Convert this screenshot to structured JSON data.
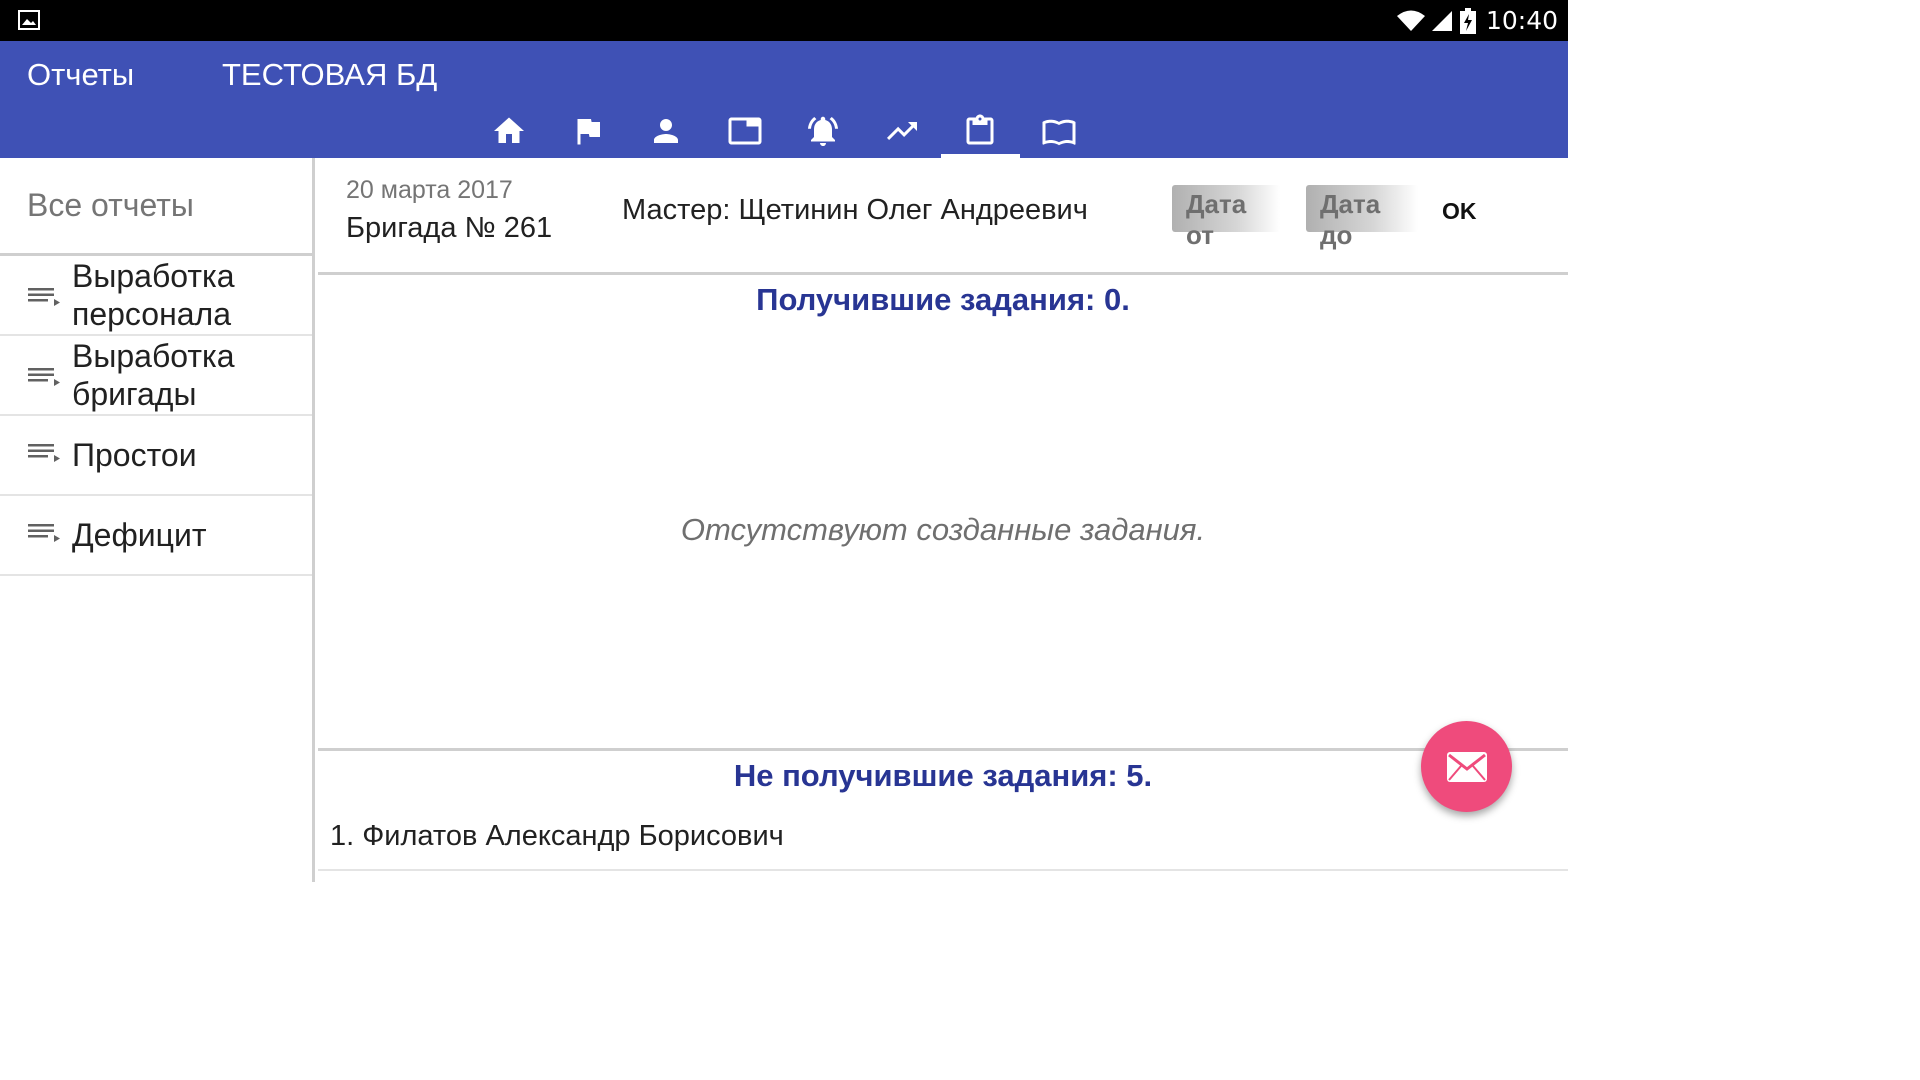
{
  "status_bar": {
    "time": "10:40",
    "icons": [
      "gallery-icon",
      "wifi-icon",
      "signal-icon",
      "battery-charging-icon"
    ]
  },
  "app_bar": {
    "title": "Отчеты",
    "subtitle": "ТЕСТОВАЯ БД",
    "tabs": [
      {
        "icon": "home-icon",
        "active": false
      },
      {
        "icon": "flag-icon",
        "active": false
      },
      {
        "icon": "person-icon",
        "active": false
      },
      {
        "icon": "tab-window-icon",
        "active": false
      },
      {
        "icon": "alarm-bell-icon",
        "active": false
      },
      {
        "icon": "trending-up-icon",
        "active": false
      },
      {
        "icon": "clipboard-icon",
        "active": true
      },
      {
        "icon": "book-icon",
        "active": false
      }
    ]
  },
  "sidebar": {
    "header": "Все отчеты",
    "items": [
      {
        "label_line1": "Выработка",
        "label_line2": "персонала",
        "icon": "list-play-icon"
      },
      {
        "label_line1": "Выработка",
        "label_line2": "бригады",
        "icon": "list-play-icon"
      },
      {
        "label_line1": "Простои",
        "label_line2": "",
        "icon": "list-play-icon"
      },
      {
        "label_line1": "Дефицит",
        "label_line2": "",
        "icon": "list-play-icon"
      }
    ]
  },
  "content": {
    "date": "20 марта 2017",
    "brigade": "Бригада № 261",
    "master": "Мастер: Щетинин Олег Андреевич",
    "date_from_label": "Дата от",
    "date_to_label": "Дата до",
    "ok_label": "OK",
    "received_title": "Получившие задания:  0.",
    "empty_message": "Отсутствуют созданные задания.",
    "not_received_title": "Не получившие задания: 5.",
    "not_received_list": [
      "1.  Филатов Александр Борисович"
    ]
  },
  "colors": {
    "app_bar": "#3f51b5",
    "section_title": "#283593",
    "fab": "#ef4b7c"
  },
  "fab": {
    "icon": "mail-icon"
  }
}
